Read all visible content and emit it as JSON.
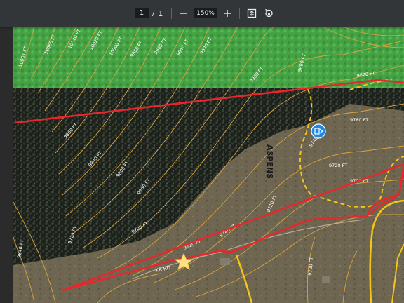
{
  "toolbar": {
    "current_page": "1",
    "page_separator": "/",
    "total_pages": "1",
    "zoom_level": "150%",
    "zoom_out_icon": "minus-icon",
    "zoom_in_icon": "plus-icon",
    "fit_icon": "fit-page-icon",
    "rotate_icon": "rotate-icon"
  },
  "map": {
    "place_label": "ASPENS",
    "road_label": "KR RD",
    "colors": {
      "boundary": "#e8262b",
      "contour": "#d9a441",
      "trail": "#f5c518",
      "forest_green": "#4caf50",
      "marker": "#1e88e5",
      "star": "#ffe082"
    },
    "contour_labels": [
      "10001 FT",
      "10060 FT",
      "10040 FT",
      "10020 FT",
      "10000 FT",
      "9980 FT",
      "9960 FT",
      "9940 FT",
      "9920 FT",
      "9900 FT",
      "9880 FT",
      "9860 FT",
      "9840 FT",
      "9820 FT",
      "9800 FT",
      "9780 FT",
      "9760 FT",
      "9740 FT",
      "9720 FT",
      "9700 FT"
    ]
  }
}
